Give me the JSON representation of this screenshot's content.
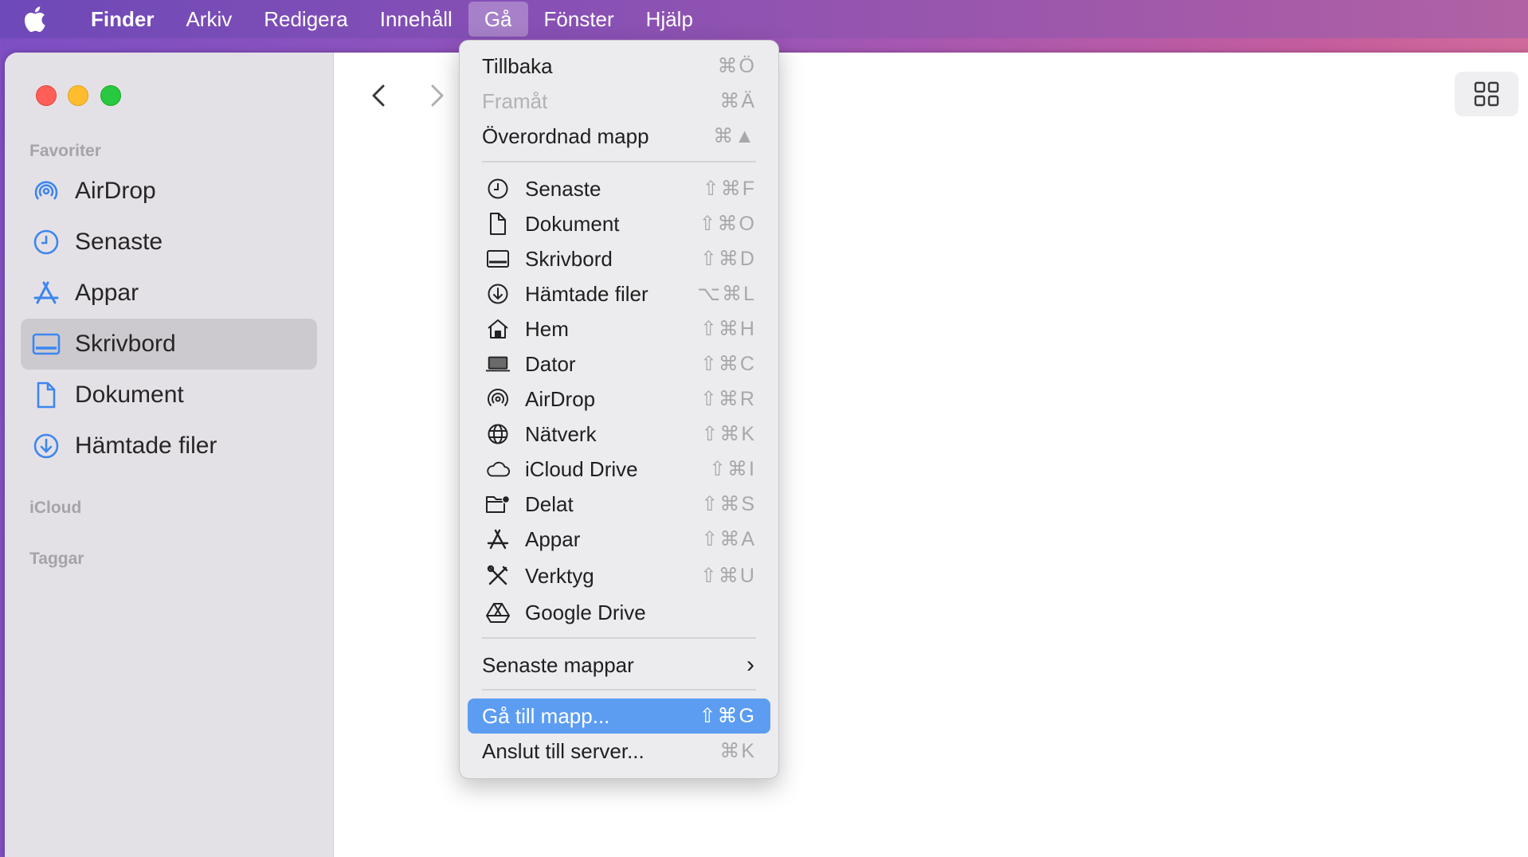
{
  "menubar": {
    "app_name": "Finder",
    "items": [
      "Arkiv",
      "Redigera",
      "Innehåll",
      "Gå",
      "Fönster",
      "Hjälp"
    ],
    "active": "Gå"
  },
  "sidebar": {
    "favorites_header": "Favoriter",
    "favorites": [
      {
        "label": "AirDrop",
        "icon": "airdrop-icon"
      },
      {
        "label": "Senaste",
        "icon": "clock-icon"
      },
      {
        "label": "Appar",
        "icon": "apps-icon"
      },
      {
        "label": "Skrivbord",
        "icon": "desktop-icon",
        "selected": true
      },
      {
        "label": "Dokument",
        "icon": "document-icon"
      },
      {
        "label": "Hämtade filer",
        "icon": "download-icon"
      }
    ],
    "icloud_header": "iCloud",
    "tags_header": "Taggar"
  },
  "go_menu": {
    "top_items": [
      {
        "label": "Tillbaka",
        "shortcut": "⌘Ö"
      },
      {
        "label": "Framåt",
        "shortcut": "⌘Ä",
        "disabled": true
      },
      {
        "label": "Överordnad mapp",
        "shortcut": "⌘▲"
      }
    ],
    "places": [
      {
        "label": "Senaste",
        "shortcut": "⇧⌘F",
        "icon": "clock-icon"
      },
      {
        "label": "Dokument",
        "shortcut": "⇧⌘O",
        "icon": "document-icon"
      },
      {
        "label": "Skrivbord",
        "shortcut": "⇧⌘D",
        "icon": "desktop-icon"
      },
      {
        "label": "Hämtade filer",
        "shortcut": "⌥⌘L",
        "icon": "download-icon"
      },
      {
        "label": "Hem",
        "shortcut": "⇧⌘H",
        "icon": "home-icon"
      },
      {
        "label": "Dator",
        "shortcut": "⇧⌘C",
        "icon": "laptop-icon"
      },
      {
        "label": "AirDrop",
        "shortcut": "⇧⌘R",
        "icon": "airdrop-icon"
      },
      {
        "label": "Nätverk",
        "shortcut": "⇧⌘K",
        "icon": "globe-icon"
      },
      {
        "label": "iCloud Drive",
        "shortcut": "⇧⌘I",
        "icon": "cloud-icon"
      },
      {
        "label": "Delat",
        "shortcut": "⇧⌘S",
        "icon": "shared-folder-icon"
      },
      {
        "label": "Appar",
        "shortcut": "⇧⌘A",
        "icon": "apps-icon"
      },
      {
        "label": "Verktyg",
        "shortcut": "⇧⌘U",
        "icon": "tools-icon"
      },
      {
        "label": "Google Drive",
        "shortcut": "",
        "icon": "google-drive-icon"
      }
    ],
    "recent_folders": {
      "label": "Senaste mappar",
      "shortcut": "›"
    },
    "goto_folder": {
      "label": "Gå till mapp...",
      "shortcut": "⇧⌘G"
    },
    "connect_server": {
      "label": "Anslut till server...",
      "shortcut": "⌘K"
    }
  }
}
